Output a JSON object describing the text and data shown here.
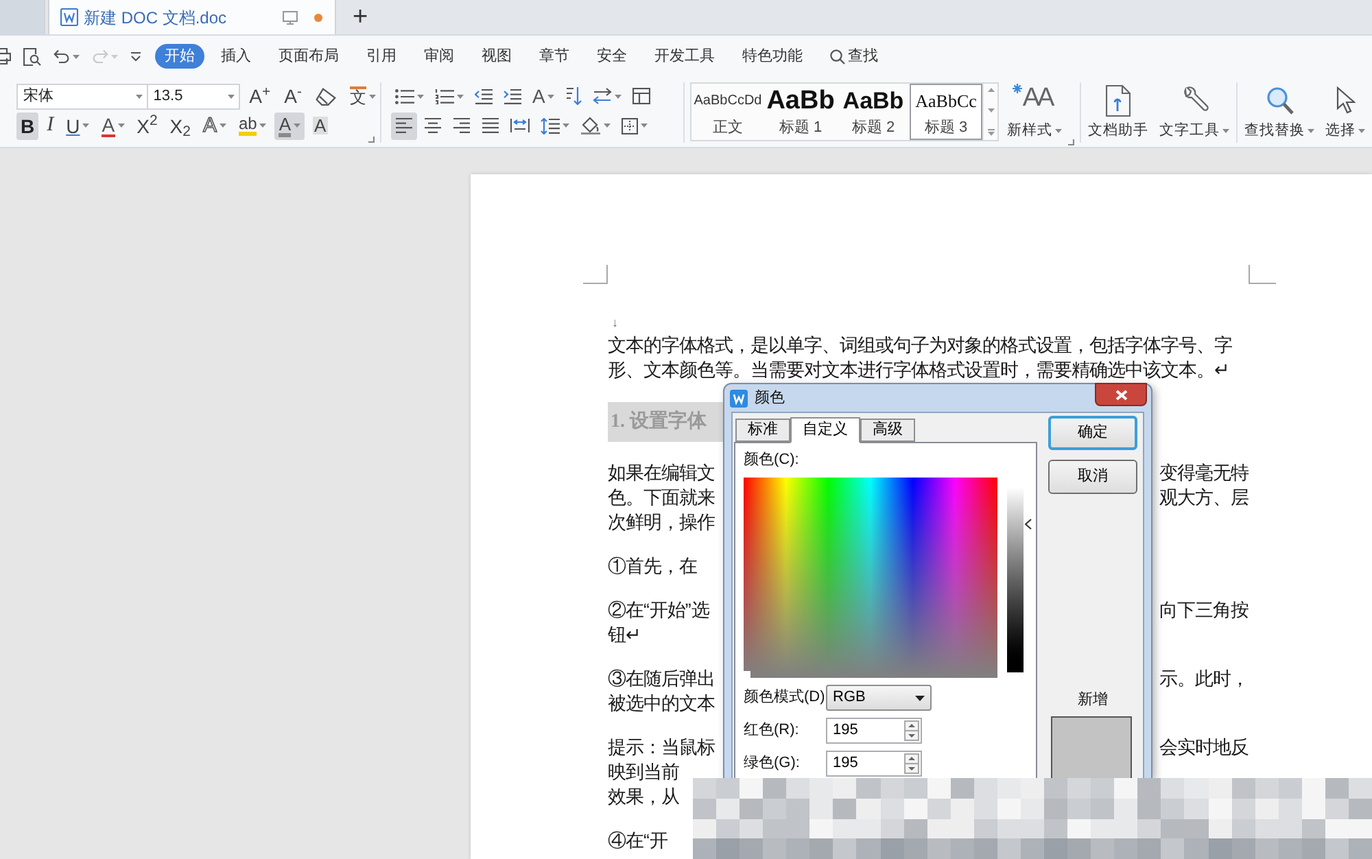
{
  "tabs": [
    {
      "kind": "partial",
      "selected": false
    },
    {
      "kind": "document",
      "title": "新建 DOC 文档.doc",
      "selected": true,
      "unsaved": true
    }
  ],
  "new_tab": "+",
  "quick_access": [
    {
      "kind": "print",
      "dropdown": false,
      "disabled": false
    },
    {
      "kind": "preview",
      "dropdown": false,
      "disabled": false
    },
    {
      "kind": "undo",
      "dropdown": true,
      "disabled": false
    },
    {
      "kind": "redo",
      "dropdown": true,
      "disabled": true
    },
    {
      "kind": "customize",
      "dropdown": false,
      "disabled": false
    }
  ],
  "menu": [
    {
      "kind": "tab",
      "label": "开始",
      "selected": true
    },
    {
      "kind": "tab",
      "label": "插入",
      "selected": false
    },
    {
      "kind": "tab",
      "label": "页面布局",
      "selected": false
    },
    {
      "kind": "tab",
      "label": "引用",
      "selected": false
    },
    {
      "kind": "tab",
      "label": "审阅",
      "selected": false
    },
    {
      "kind": "tab",
      "label": "视图",
      "selected": false
    },
    {
      "kind": "tab",
      "label": "章节",
      "selected": false
    },
    {
      "kind": "tab",
      "label": "安全",
      "selected": false
    },
    {
      "kind": "tab",
      "label": "开发工具",
      "selected": false
    },
    {
      "kind": "tab",
      "label": "特色功能",
      "selected": false
    },
    {
      "kind": "search",
      "label": "查找",
      "selected": false
    }
  ],
  "ribbon": {
    "font": {
      "name": "宋体",
      "size": "13.5"
    },
    "font_tools": [
      {
        "kind": "grow-font",
        "glyph": "A$^{+}$",
        "dropdown": false
      },
      {
        "kind": "shrink-font",
        "glyph": "A$^{-}$",
        "dropdown": false
      },
      {
        "kind": "clear-format",
        "dropdown": false
      },
      {
        "kind": "phonetic-guide",
        "glyph": "文",
        "dropdown": true
      }
    ],
    "format_tools": [
      {
        "kind": "bold",
        "glyph": "B",
        "on": true,
        "dropdown": false
      },
      {
        "kind": "italic",
        "glyph": "I",
        "on": false,
        "dropdown": false
      },
      {
        "kind": "underline",
        "glyph": "U",
        "on": false,
        "dropdown": true
      },
      {
        "kind": "strikethrough",
        "glyph": "A",
        "on": false,
        "dropdown": true
      },
      {
        "kind": "superscript",
        "glyph": "X$^{2}$",
        "on": false,
        "dropdown": false
      },
      {
        "kind": "subscript",
        "glyph": "X$_{2}$",
        "on": false,
        "dropdown": false
      },
      {
        "kind": "text-effects",
        "glyph": "A",
        "on": false,
        "dropdown": true
      },
      {
        "kind": "highlight",
        "glyph": "ab",
        "on": false,
        "dropdown": true
      },
      {
        "kind": "font-color",
        "glyph": "A",
        "on": true,
        "dropdown": true
      },
      {
        "kind": "char-shading",
        "glyph": "A",
        "on": false,
        "dropdown": false
      }
    ],
    "paragraph_tools": [
      {
        "kind": "bullets",
        "dropdown": true
      },
      {
        "kind": "numbering",
        "dropdown": true
      },
      {
        "kind": "outdent",
        "dropdown": false
      },
      {
        "kind": "indent",
        "dropdown": false
      },
      {
        "kind": "text-direction",
        "glyph": "A",
        "dropdown": true
      },
      {
        "kind": "sort",
        "dropdown": false
      },
      {
        "kind": "swap",
        "dropdown": true
      },
      {
        "kind": "table",
        "dropdown": false
      }
    ],
    "align_tools": [
      {
        "kind": "align-left",
        "on": true,
        "dropdown": false
      },
      {
        "kind": "align-center",
        "on": false,
        "dropdown": false
      },
      {
        "kind": "align-right",
        "on": false,
        "dropdown": false
      },
      {
        "kind": "justify",
        "on": false,
        "dropdown": false
      },
      {
        "kind": "distribute",
        "on": false,
        "dropdown": false
      },
      {
        "kind": "line-spacing",
        "on": false,
        "dropdown": true
      },
      {
        "kind": "shading",
        "on": false,
        "dropdown": true
      },
      {
        "kind": "borders",
        "on": false,
        "dropdown": true
      }
    ],
    "styles": [
      {
        "preview": "AaBbCcDd",
        "label": "正文",
        "selected": false
      },
      {
        "preview": "AaBb",
        "label": "标题 1",
        "selected": false
      },
      {
        "preview": "AaBb",
        "label": "标题 2",
        "selected": false
      },
      {
        "preview": "AaBbCc",
        "label": "标题 3",
        "selected": true
      }
    ],
    "button_groups": [
      [
        {
          "kind": "new-style",
          "glyph": "AA",
          "label": "新样式",
          "dropdown": true
        }
      ],
      [
        {
          "kind": "doc-assistant",
          "label": "文档助手",
          "dropdown": false
        },
        {
          "kind": "text-tools",
          "label": "文字工具",
          "dropdown": true
        }
      ],
      [
        {
          "kind": "find-replace",
          "label": "查找替换",
          "dropdown": true
        },
        {
          "kind": "select",
          "label": "选择",
          "dropdown": true
        }
      ]
    ]
  },
  "document": {
    "paragraphs": [
      {
        "kind": "mark",
        "lines": [
          [
            "↓"
          ]
        ]
      },
      {
        "kind": "body",
        "lines": [
          [
            "文本的字体格式，是以单字、词组或句子为对象的格式设置，包括字体字号、字"
          ],
          [
            "形、文本颜色等。当需要对文本进行字体格式设置时，需要精确选中该文本。↵"
          ]
        ]
      },
      {
        "kind": "heading",
        "lines": [
          [
            "1. 设置字体"
          ]
        ]
      },
      {
        "kind": "body",
        "lines": [
          [
            "如果在编辑文",
            "变得毫无特"
          ],
          [
            "色。下面就来",
            "观大方、层"
          ],
          [
            "次鲜明，操作"
          ]
        ]
      },
      {
        "kind": "body",
        "lines": [
          [
            "①首先，在"
          ]
        ]
      },
      {
        "kind": "body",
        "lines": [
          [
            "②在“开始”选",
            "向下三角按"
          ],
          [
            "钮↵"
          ]
        ]
      },
      {
        "kind": "body",
        "lines": [
          [
            "③在随后弹出",
            "示。此时，"
          ],
          [
            "被选中的文本"
          ]
        ]
      },
      {
        "kind": "body",
        "lines": [
          [
            "提示：当鼠标",
            "会实时地反"
          ],
          [
            "映到当前"
          ],
          [
            "效果，从"
          ]
        ]
      },
      {
        "kind": "body",
        "lines": [
          [
            "④在“开"
          ]
        ]
      }
    ]
  },
  "dialog": {
    "title": "颜色",
    "tabs": [
      {
        "label": "标准",
        "selected": false
      },
      {
        "label": "自定义",
        "selected": true
      },
      {
        "label": "高级",
        "selected": false
      }
    ],
    "color_label": "颜色(C):",
    "luminance": {
      "level": 0.8
    },
    "mode": {
      "label": "颜色模式(D)",
      "value": "RGB"
    },
    "channels": [
      {
        "label": "红色(R):",
        "value": "195"
      },
      {
        "label": "绿色(G):",
        "value": "195"
      }
    ],
    "buttons": [
      {
        "label": "确定",
        "default": true
      },
      {
        "label": "取消",
        "default": false
      }
    ],
    "new_label": "新增"
  }
}
